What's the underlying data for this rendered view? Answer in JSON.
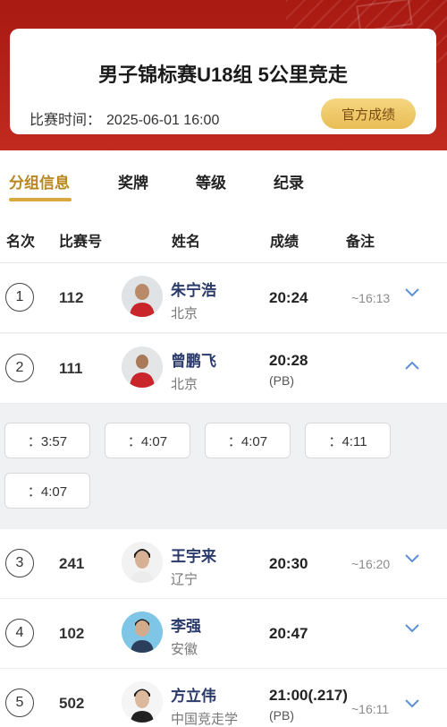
{
  "event": {
    "title": "男子锦标赛U18组 5公里竞走",
    "time_label": "比赛时间：",
    "time_value": "2025-06-01  16:00",
    "official_button": "官方成绩"
  },
  "tabs": [
    {
      "label": "分组信息",
      "active": true
    },
    {
      "label": "奖牌",
      "active": false
    },
    {
      "label": "等级",
      "active": false
    },
    {
      "label": "纪录",
      "active": false
    }
  ],
  "columns": {
    "rank": "名次",
    "bib": "比赛号",
    "name": "姓名",
    "result": "成绩",
    "note": "备注"
  },
  "rows": [
    {
      "rank": "1",
      "bib": "112",
      "name": "朱宁浩",
      "province": "北京",
      "result": "20:24",
      "pb": "",
      "note": "~16:13",
      "expanded": false
    },
    {
      "rank": "2",
      "bib": "111",
      "name": "曾鹏飞",
      "province": "北京",
      "result": "20:28",
      "pb": "(PB)",
      "note": "",
      "expanded": true
    },
    {
      "rank": "3",
      "bib": "241",
      "name": "王宇来",
      "province": "辽宁",
      "result": "20:30",
      "pb": "",
      "note": "~16:20",
      "expanded": false
    },
    {
      "rank": "4",
      "bib": "102",
      "name": "李强",
      "province": "安徽",
      "result": "20:47",
      "pb": "",
      "note": "",
      "expanded": false
    },
    {
      "rank": "5",
      "bib": "502",
      "name": "方立伟",
      "province": "中国竞走学",
      "result": "21:00(.217)",
      "pb": "(PB)",
      "note": "~16:11",
      "expanded": false
    }
  ],
  "splits": [
    "：3:57",
    "：4:07",
    "：4:07",
    "：4:11",
    "：4:07"
  ],
  "colors": {
    "hero_red": "#b7231a",
    "gold": "#d9a93c",
    "chevron": "#5b8fd6"
  },
  "icons": {
    "expand": "chevron-down-icon",
    "collapse": "chevron-up-icon"
  }
}
